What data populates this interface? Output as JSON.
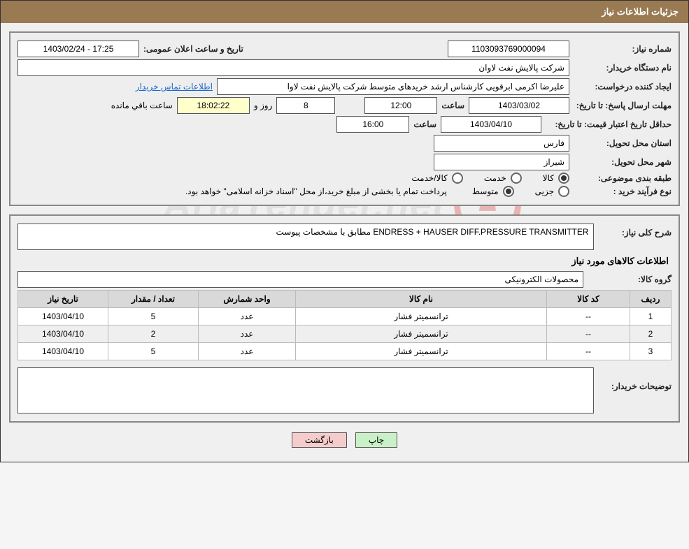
{
  "watermark": "AriaTender.net",
  "header_title": "جزئیات اطلاعات نیاز",
  "labels": {
    "need_no": "شماره نیاز:",
    "announce_date": "تاریخ و ساعت اعلان عمومی:",
    "buyer_org": "نام دستگاه خریدار:",
    "requester": "ایجاد کننده درخواست:",
    "buyer_contact": "اطلاعات تماس خریدار",
    "answer_deadline": "مهلت ارسال پاسخ: تا تاریخ:",
    "hour": "ساعت",
    "days_and": "روز و",
    "remaining": "ساعت باقي مانده",
    "price_validity": "حداقل تاریخ اعتبار قیمت: تا تاریخ:",
    "delivery_province": "استان محل تحویل:",
    "delivery_city": "شهر محل تحویل:",
    "subject_class": "طبقه بندی موضوعی:",
    "goods": "کالا",
    "service": "خدمت",
    "goods_service": "کالا/خدمت",
    "purchase_type": "نوع فرآیند خرید :",
    "partial": "جزیی",
    "medium": "متوسط",
    "payment_note": "پرداخت تمام یا بخشی از مبلغ خرید،از محل \"اسناد خزانه اسلامی\" خواهد بود.",
    "need_desc_label": "شرح کلی نیاز:",
    "items_title": "اطلاعات کالاهای مورد نیاز",
    "goods_group": "گروه کالا:",
    "buyer_notes": "توضیحات خریدار:"
  },
  "values": {
    "need_no": "1103093769000094",
    "announce_date": "1403/02/24 - 17:25",
    "buyer_org": "شرکت پالایش نفت لاوان",
    "requester": "علیرضا اکرمی ابرقویی کارشناس ارشد خریدهای متوسط شرکت پالایش نفت لاوا",
    "answer_date": "1403/03/02",
    "answer_time": "12:00",
    "days_left": "8",
    "time_left": "18:02:22",
    "price_valid_date": "1403/04/10",
    "price_valid_time": "16:00",
    "province": "فارس",
    "city": "شیراز",
    "need_desc": "ENDRESS + HAUSER DIFF.PRESSURE TRANSMITTER مطابق با مشخصات پیوست",
    "goods_group": "محصولات الکترونیکی",
    "buyer_notes": ""
  },
  "table": {
    "headers": {
      "row": "ردیف",
      "code": "کد کالا",
      "name": "نام کالا",
      "unit": "واحد شمارش",
      "qty": "تعداد / مقدار",
      "date": "تاریخ نیاز"
    },
    "rows": [
      {
        "row": "1",
        "code": "--",
        "name": "ترانسمیتر فشار",
        "unit": "عدد",
        "qty": "5",
        "date": "1403/04/10"
      },
      {
        "row": "2",
        "code": "--",
        "name": "ترانسمیتر فشار",
        "unit": "عدد",
        "qty": "2",
        "date": "1403/04/10"
      },
      {
        "row": "3",
        "code": "--",
        "name": "ترانسمیتر فشار",
        "unit": "عدد",
        "qty": "5",
        "date": "1403/04/10"
      }
    ]
  },
  "buttons": {
    "print": "چاپ",
    "back": "بازگشت"
  }
}
